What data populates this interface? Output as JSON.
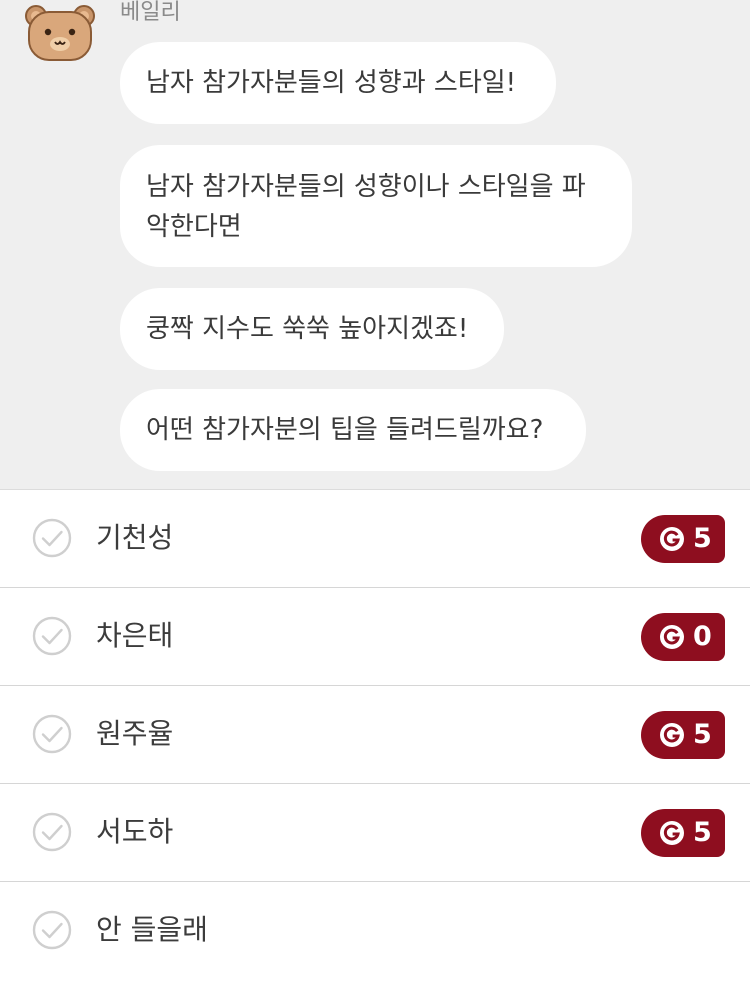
{
  "chat": {
    "sender": "베일리",
    "avatar_icon": "bear-face-icon",
    "messages": [
      "남자 참가자분들의 성향과 스타일!",
      "남자 참가자분들의 성향이나 스타일을 파악한다면",
      "쿵짝 지수도 쑥쑥 높아지겠죠!",
      "어떤 참가자분의 팁을 들려드릴까요?"
    ]
  },
  "options": [
    {
      "label": "기천성",
      "cost": "5",
      "has_cost": true
    },
    {
      "label": "차은태",
      "cost": "0",
      "has_cost": true
    },
    {
      "label": "원주율",
      "cost": "5",
      "has_cost": true
    },
    {
      "label": "서도하",
      "cost": "5",
      "has_cost": true
    },
    {
      "label": "안 들을래",
      "cost": null,
      "has_cost": false
    }
  ],
  "colors": {
    "chat_background": "#efefef",
    "bubble": "#ffffff",
    "badge": "#8e0e1f",
    "check": "#cfcfcf"
  },
  "icons": {
    "option_check": "check-circle-icon",
    "coin": "coin-g-icon"
  }
}
